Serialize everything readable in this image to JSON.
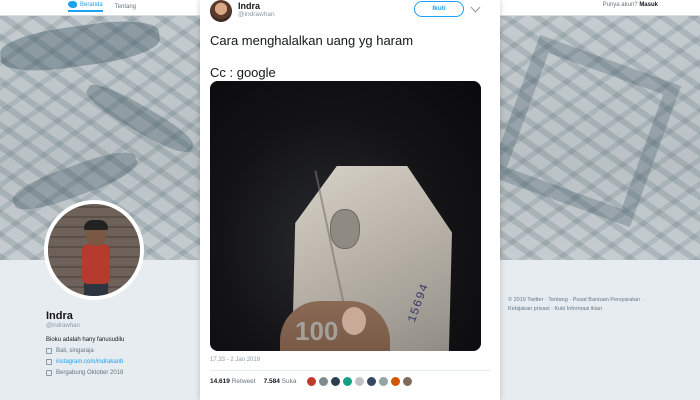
{
  "topbar": {
    "home_label": "Beranda",
    "about_label": "Tentang",
    "have_account_text": "Punya akun?",
    "login_label": "Masuk"
  },
  "profile": {
    "name": "Indra",
    "handle": "@indrawhan",
    "bio": "Bioku adalah hany fanusudilu",
    "location": "Bali, singaraja",
    "link": "instagram.com/indrakanb",
    "joined": "Bergabung Oktober 2018"
  },
  "footer": {
    "text": "© 2019 Twitter · Tentang · Pusat Bantuan Persyaratan · Kebijakan privasi · Kuki Informasi iklan"
  },
  "tweet": {
    "author_name": "Indra",
    "author_handle": "@indrawhan",
    "follow_label": "Ikuti",
    "text_line1": "Cara menghalalkan uang yg haram",
    "text_line2": "Cc : google",
    "timestamp": "17.33 - 2 Jan 2019",
    "retweets_count": "14.619",
    "retweets_label": "Retweet",
    "likes_count": "7.584",
    "likes_label": "Suka",
    "note_serial": "15694",
    "note_denomination": "100"
  },
  "colors": {
    "accent": "#1da1f2",
    "background": "#e6ecf0"
  }
}
